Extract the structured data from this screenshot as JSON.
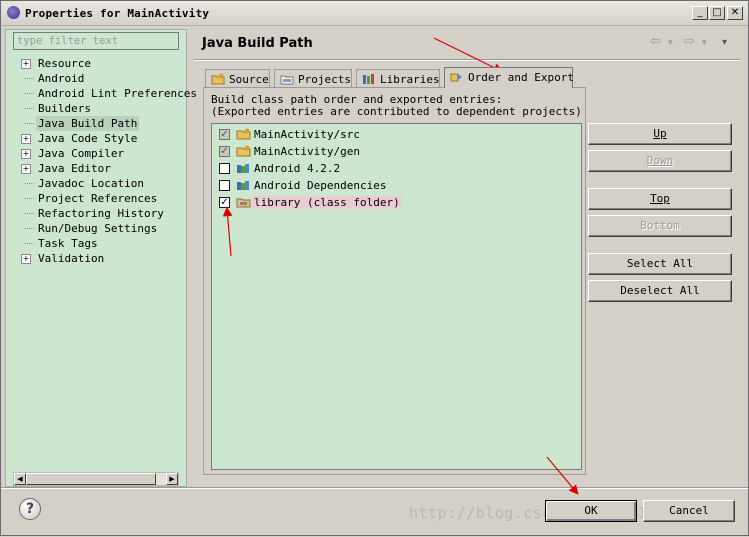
{
  "window": {
    "title": "Properties for MainActivity",
    "buttons": [
      "_",
      "□",
      "✕"
    ]
  },
  "filter": {
    "placeholder": "type filter text"
  },
  "tree": [
    {
      "label": "Resource",
      "expandable": true
    },
    {
      "label": "Android",
      "expandable": false
    },
    {
      "label": "Android Lint Preferences",
      "expandable": false
    },
    {
      "label": "Builders",
      "expandable": false
    },
    {
      "label": "Java Build Path",
      "expandable": false,
      "selected": true
    },
    {
      "label": "Java Code Style",
      "expandable": true
    },
    {
      "label": "Java Compiler",
      "expandable": true
    },
    {
      "label": "Java Editor",
      "expandable": true
    },
    {
      "label": "Javadoc Location",
      "expandable": false
    },
    {
      "label": "Project References",
      "expandable": false
    },
    {
      "label": "Refactoring History",
      "expandable": false
    },
    {
      "label": "Run/Debug Settings",
      "expandable": false
    },
    {
      "label": "Task Tags",
      "expandable": false
    },
    {
      "label": "Validation",
      "expandable": true
    }
  ],
  "page": {
    "title": "Java Build Path",
    "nav": {
      "back": "⇦",
      "forward": "⇨",
      "menu": "▾"
    }
  },
  "tabs": [
    {
      "label": "Source",
      "icon": "source-folder-icon"
    },
    {
      "label": "Projects",
      "icon": "projects-icon"
    },
    {
      "label": "Libraries",
      "icon": "libraries-icon"
    },
    {
      "label": "Order and Export",
      "icon": "order-export-icon",
      "active": true
    }
  ],
  "order_export": {
    "description_line1": "Build class path order and exported entries:",
    "description_line2": "(Exported entries are contributed to dependent projects)",
    "entries": [
      {
        "label": "MainActivity/src",
        "checked": true,
        "grayed": true,
        "icon": "source-folder-icon"
      },
      {
        "label": "MainActivity/gen",
        "checked": true,
        "grayed": true,
        "icon": "source-folder-icon"
      },
      {
        "label": "Android 4.2.2",
        "checked": false,
        "grayed": false,
        "icon": "library-icon"
      },
      {
        "label": "Android Dependencies",
        "checked": false,
        "grayed": false,
        "icon": "library-icon"
      },
      {
        "label": "library (class folder)",
        "checked": true,
        "grayed": false,
        "icon": "class-folder-icon",
        "selected": true
      }
    ],
    "buttons": {
      "up": "Up",
      "down": "Down",
      "top": "Top",
      "bottom": "Bottom",
      "select_all": "Select All",
      "deselect_all": "Deselect All"
    }
  },
  "footer": {
    "help": "?",
    "ok": "OK",
    "cancel": "Cancel",
    "watermark": "http://blog.csdn.net/u011647962"
  },
  "colors": {
    "panel_background": "#cce6cf",
    "dialog_background": "#d4d0c8",
    "annotation_arrow": "#e00000",
    "selected_row": "#e9cdd3"
  }
}
